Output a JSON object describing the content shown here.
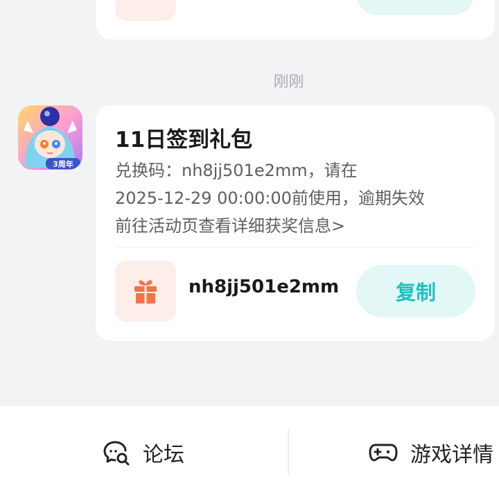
{
  "time_label": "刚刚",
  "message": {
    "title": "11日签到礼包",
    "body_lines": [
      "兑换码：nh8jj501e2mm，请在",
      "2025-12-29 00:00:00前使用，逾期失效",
      "前往活动页查看详细获奖信息>"
    ],
    "code": "nh8jj501e2mm",
    "copy_label": "复制",
    "avatar_badge": "3周年"
  },
  "bottom_bar": {
    "forum_label": "论坛",
    "detail_label": "游戏详情"
  },
  "colors": {
    "background": "#f2f3f5",
    "accent": "#1cc2c0",
    "gift": "#f5734a"
  }
}
